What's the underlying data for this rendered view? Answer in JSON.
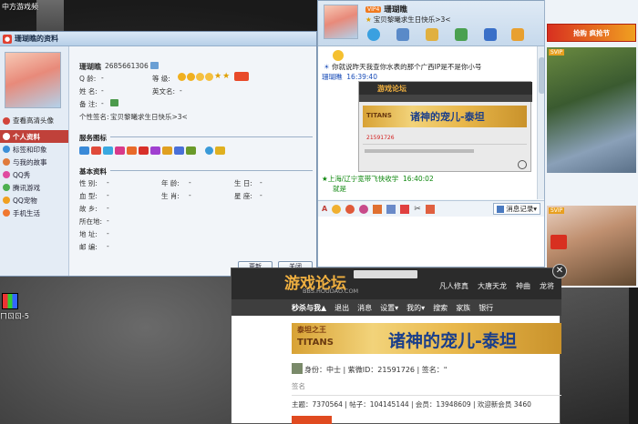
{
  "desktop": {
    "top_label": "中方游戏频",
    "icon_label": "ㄇㄖㄖ-5"
  },
  "profile_window": {
    "title": "珊瑚瞧的资料",
    "nickname": "珊瑚瞧",
    "qq_number": "2685661306",
    "labels": {
      "q_age": "Q 龄:",
      "q_age_val": "-",
      "level": "等 级:",
      "name": "姓 名:",
      "name_val": "-",
      "english_name": "英文名:",
      "english_name_val": "-",
      "remark": "备 注:",
      "remark_val": "-",
      "signature_label": "个性签名:",
      "signature": "宝贝黎曦求生日快乐>3<"
    },
    "view_hd_avatar": "查看高清头像",
    "nav": [
      {
        "label": "个人资料",
        "color": "#ffffff"
      },
      {
        "label": "标签和印象",
        "color": "#3a8fd8"
      },
      {
        "label": "与我的故事",
        "color": "#e07b3c"
      },
      {
        "label": "QQ秀",
        "color": "#e04aa0"
      },
      {
        "label": "腾讯游戏",
        "color": "#4caf50"
      },
      {
        "label": "QQ宠物",
        "color": "#f0a020"
      },
      {
        "label": "手机生活",
        "color": "#f07830"
      }
    ],
    "service_icons_title": "服务图标",
    "basic_info_title": "基本资料",
    "basic": {
      "gender": "性 别:",
      "gender_val": "-",
      "age": "年 龄:",
      "age_val": "-",
      "birthday": "生 日:",
      "birthday_val": "-",
      "blood": "血 型:",
      "blood_val": "-",
      "zodiac": "生 肖:",
      "zodiac_val": "-",
      "star": "星 座:",
      "star_val": "-",
      "hometown": "故 乡:",
      "hometown_val": "-",
      "location": "所在地:",
      "location_val": "-",
      "address": "地 址:",
      "address_val": "-",
      "email": "邮 编:",
      "email_val": "-"
    },
    "update_button": "更新",
    "close_button": "关闭"
  },
  "chat_window": {
    "contact_name": "珊瑚瞧",
    "vip_badge": "VIP4",
    "status": "宝贝黎曦求生日快乐>3<",
    "message_1": "你就说昨天我查你水表的那个广西IP是不是你小号",
    "sender_1": "珊瑚瞧",
    "time_1": "16:39:40",
    "image_footer_id": "21591726",
    "sender_2": "★上海/辽宁宽带飞快收学",
    "time_2": "16:40:02",
    "message_2": "就是",
    "message_history": "消息记录",
    "banner_text": "诸神的宠儿-泰坦",
    "banner_logo": "TITANS",
    "forum_logo_mini": "游戏论坛"
  },
  "side_panel": {
    "promo_label": "抢购 疯抢节",
    "vip_tag_1": "SVIP",
    "vip_tag_2": "SVIP"
  },
  "forum_window": {
    "logo_text": "游戏论坛",
    "logo_sub": "BBS.HOUDAO.COM",
    "top_links": [
      "凡人修真",
      "大唐天龙",
      "神曲",
      "龙将"
    ],
    "nav": [
      "秒杀与我▲",
      "退出",
      "消息",
      "设置▾",
      "我的▾",
      "搜索",
      "家族",
      "银行"
    ],
    "banner_text": "诸神的宠儿-泰坦",
    "banner_logo_top": "泰坦之王",
    "banner_logo": "TITANS",
    "user_line": "身份：中士 | 紫微ID：21591726 | 签名：\"",
    "sign_label": "签名",
    "stats": "主题：7370564 | 帖子：104145144 | 会员：13948609 | 欢迎新会员   3460"
  },
  "colors": {
    "accent_red": "#c0413a",
    "window_border": "#7b93b0",
    "link_blue": "#1a4db8",
    "forum_id_red": "#d32020",
    "chat_green": "#108810"
  }
}
